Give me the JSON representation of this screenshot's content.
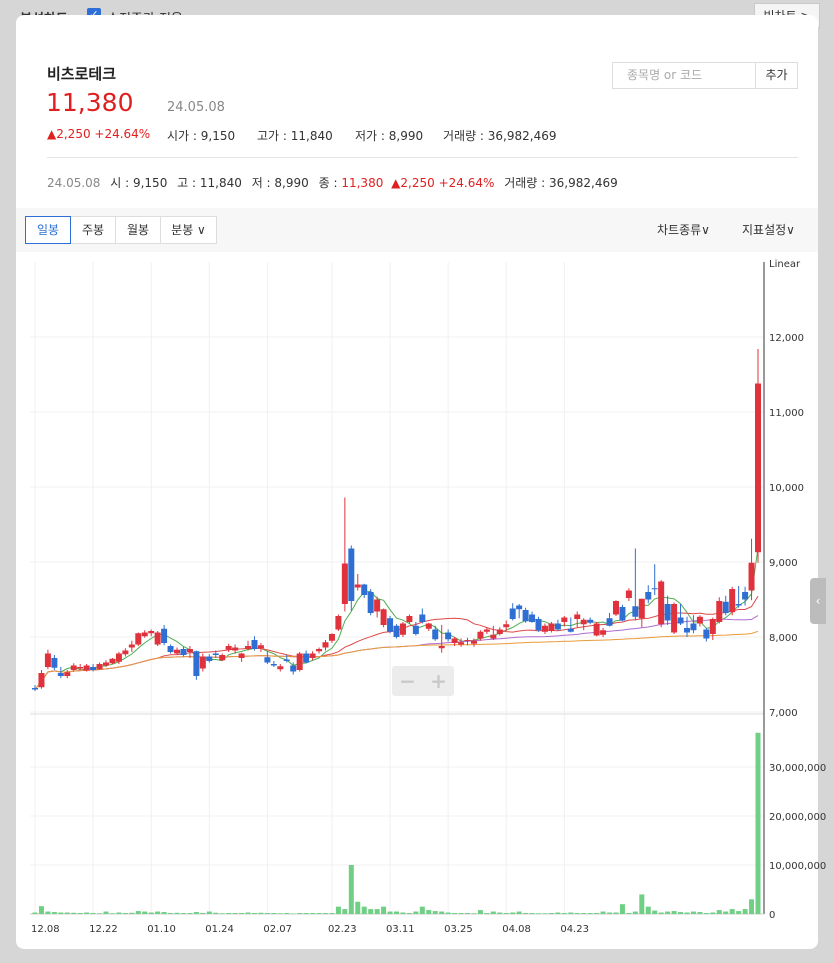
{
  "topbar": {
    "title": "분석차트",
    "adjusted_label": "수정주가 적용",
    "big_chart_label": "빅차트 >"
  },
  "stock": {
    "name": "비츠로테크",
    "price": "11,380",
    "date": "24.05.08",
    "change": "▲2,250 +24.64%"
  },
  "ohlc": {
    "open_label": "시가 : 9,150",
    "high_label": "고가 : 11,840",
    "low_label": "저가 : 8,990",
    "volume_label": "거래량 : 36,982,469"
  },
  "search": {
    "placeholder": "종목명 or 코드",
    "add_label": "추가"
  },
  "summary": {
    "date": "24.05.08",
    "open": "시 : 9,150",
    "high": "고 : 11,840",
    "low": "저 : 8,990",
    "close_label": "종 :",
    "close_value": "11,380",
    "change": "▲2,250 +24.64%",
    "volume": "거래량 : 36,982,469"
  },
  "tabs": [
    {
      "label": "일봉",
      "active": true
    },
    {
      "label": "주봉",
      "active": false
    },
    {
      "label": "월봉",
      "active": false
    },
    {
      "label": "분봉 ∨",
      "active": false
    }
  ],
  "menus": {
    "chart_type": "차트종류∨",
    "indicator": "지표설정∨"
  },
  "zoom": {
    "minus": "−",
    "plus": "+"
  },
  "handle": {
    "icon": "‹"
  },
  "colors": {
    "up": "#e0323c",
    "down": "#2f6fd3",
    "volume": "#6fcf85",
    "ma5": "#4caf50",
    "ma20": "#e04848",
    "ma60": "#b06ad0",
    "ma120": "#e89a3a"
  },
  "chart_data": {
    "type": "candlestick",
    "scale_label": "Linear",
    "price_ticks": [
      "12,000",
      "11,000",
      "10,000",
      "9,000",
      "8,000",
      "7,000"
    ],
    "price_values": [
      12000,
      11000,
      10000,
      9000,
      8000,
      7000
    ],
    "volume_ticks": [
      "30,000,000",
      "20,000,000",
      "10,000,000",
      "0"
    ],
    "volume_values": [
      30000000,
      20000000,
      10000000,
      0
    ],
    "x_labels": [
      "12.08",
      "12.22",
      "01.10",
      "01.24",
      "02.07",
      "02.23",
      "03.11",
      "03.25",
      "04.08",
      "04.23"
    ],
    "candles": [
      [
        7320,
        7360,
        7280,
        7300,
        300000
      ],
      [
        7330,
        7560,
        7310,
        7520,
        1600000
      ],
      [
        7600,
        7830,
        7570,
        7780,
        500000
      ],
      [
        7720,
        7760,
        7560,
        7590,
        400000
      ],
      [
        7520,
        7600,
        7450,
        7480,
        300000
      ],
      [
        7480,
        7560,
        7450,
        7530,
        300000
      ],
      [
        7560,
        7650,
        7540,
        7620,
        250000
      ],
      [
        7580,
        7640,
        7560,
        7600,
        200000
      ],
      [
        7550,
        7640,
        7540,
        7620,
        300000
      ],
      [
        7600,
        7640,
        7540,
        7560,
        200000
      ],
      [
        7570,
        7660,
        7560,
        7640,
        150000
      ],
      [
        7620,
        7690,
        7600,
        7660,
        500000
      ],
      [
        7650,
        7720,
        7640,
        7710,
        150000
      ],
      [
        7670,
        7800,
        7640,
        7780,
        300000
      ],
      [
        7770,
        7850,
        7740,
        7820,
        200000
      ],
      [
        7860,
        7950,
        7800,
        7900,
        250000
      ],
      [
        7900,
        8060,
        7880,
        8050,
        600000
      ],
      [
        8010,
        8090,
        7990,
        8060,
        500000
      ],
      [
        8050,
        8100,
        8010,
        8080,
        300000
      ],
      [
        7900,
        8080,
        7880,
        8060,
        500000
      ],
      [
        8110,
        8160,
        7890,
        7920,
        400000
      ],
      [
        7880,
        7900,
        7780,
        7800,
        200000
      ],
      [
        7780,
        7860,
        7760,
        7830,
        250000
      ],
      [
        7840,
        7870,
        7740,
        7760,
        200000
      ],
      [
        7800,
        7880,
        7720,
        7840,
        200000
      ],
      [
        7810,
        7820,
        7430,
        7480,
        400000
      ],
      [
        7580,
        7780,
        7540,
        7740,
        200000
      ],
      [
        7740,
        7770,
        7660,
        7680,
        500000
      ],
      [
        7780,
        7820,
        7720,
        7760,
        250000
      ],
      [
        7690,
        7780,
        7680,
        7760,
        150000
      ],
      [
        7830,
        7910,
        7800,
        7880,
        200000
      ],
      [
        7820,
        7900,
        7780,
        7860,
        200000
      ],
      [
        7720,
        7790,
        7670,
        7780,
        200000
      ],
      [
        7840,
        7950,
        7820,
        7880,
        300000
      ],
      [
        7960,
        8010,
        7820,
        7840,
        200000
      ],
      [
        7850,
        7920,
        7800,
        7890,
        250000
      ],
      [
        7730,
        7810,
        7640,
        7660,
        200000
      ],
      [
        7640,
        7680,
        7600,
        7620,
        200000
      ],
      [
        7570,
        7640,
        7540,
        7610,
        150000
      ],
      [
        7700,
        7760,
        7660,
        7680,
        200000
      ],
      [
        7620,
        7660,
        7500,
        7540,
        100000
      ],
      [
        7560,
        7800,
        7540,
        7780,
        200000
      ],
      [
        7780,
        7820,
        7650,
        7660,
        200000
      ],
      [
        7720,
        7810,
        7690,
        7780,
        200000
      ],
      [
        7810,
        7860,
        7780,
        7840,
        200000
      ],
      [
        7860,
        7960,
        7820,
        7930,
        200000
      ],
      [
        7950,
        8050,
        7920,
        8040,
        200000
      ],
      [
        8100,
        8300,
        8080,
        8280,
        1500000
      ],
      [
        8440,
        9860,
        8340,
        8980,
        1000000
      ],
      [
        9180,
        9220,
        8350,
        8480,
        10000000
      ],
      [
        8660,
        8840,
        8620,
        8700,
        2500000
      ],
      [
        8700,
        8710,
        8520,
        8560,
        1500000
      ],
      [
        8600,
        8640,
        8290,
        8320,
        1000000
      ],
      [
        8340,
        8540,
        8260,
        8500,
        1000000
      ],
      [
        8160,
        8380,
        8130,
        8370,
        1500000
      ],
      [
        8250,
        8280,
        8050,
        8070,
        500000
      ],
      [
        8150,
        8170,
        7980,
        8000,
        500000
      ],
      [
        8030,
        8200,
        8000,
        8180,
        300000
      ],
      [
        8200,
        8300,
        8180,
        8280,
        200000
      ],
      [
        8150,
        8200,
        8020,
        8040,
        500000
      ],
      [
        8300,
        8380,
        8180,
        8200,
        1500000
      ],
      [
        8110,
        8190,
        8080,
        8180,
        800000
      ],
      [
        8100,
        8150,
        7950,
        7970,
        600000
      ],
      [
        7850,
        8160,
        7790,
        7880,
        500000
      ],
      [
        8060,
        8100,
        7940,
        7970,
        300000
      ],
      [
        7920,
        8000,
        7880,
        7980,
        200000
      ],
      [
        7900,
        7980,
        7870,
        7930,
        200000
      ],
      [
        7950,
        7990,
        7890,
        7960,
        200000
      ],
      [
        7910,
        7980,
        7870,
        7950,
        150000
      ],
      [
        7980,
        8090,
        7950,
        8070,
        800000
      ],
      [
        8070,
        8130,
        8040,
        8100,
        200000
      ],
      [
        7980,
        8150,
        7960,
        8030,
        500000
      ],
      [
        8040,
        8130,
        8020,
        8100,
        300000
      ],
      [
        8130,
        8220,
        8080,
        8170,
        200000
      ],
      [
        8380,
        8450,
        8220,
        8240,
        300000
      ],
      [
        8420,
        8440,
        8250,
        8370,
        500000
      ],
      [
        8360,
        8390,
        8190,
        8210,
        200000
      ],
      [
        8300,
        8340,
        8190,
        8200,
        200000
      ],
      [
        8240,
        8270,
        8070,
        8090,
        150000
      ],
      [
        8070,
        8180,
        8040,
        8150,
        150000
      ],
      [
        8080,
        8200,
        8060,
        8180,
        200000
      ],
      [
        8180,
        8230,
        8080,
        8100,
        300000
      ],
      [
        8200,
        8280,
        8140,
        8260,
        200000
      ],
      [
        8110,
        8260,
        8060,
        8070,
        300000
      ],
      [
        8240,
        8340,
        8130,
        8300,
        200000
      ],
      [
        8170,
        8250,
        8090,
        8230,
        200000
      ],
      [
        8230,
        8260,
        8170,
        8190,
        200000
      ],
      [
        8020,
        8200,
        8010,
        8180,
        200000
      ],
      [
        8030,
        8120,
        8000,
        8090,
        500000
      ],
      [
        8250,
        8320,
        8140,
        8150,
        300000
      ],
      [
        8300,
        8490,
        8280,
        8480,
        300000
      ],
      [
        8400,
        8430,
        8210,
        8220,
        2000000
      ],
      [
        8520,
        8650,
        8480,
        8620,
        200000
      ],
      [
        8410,
        9180,
        8220,
        8270,
        500000
      ],
      [
        8250,
        8510,
        8130,
        8510,
        4000000
      ],
      [
        8600,
        8690,
        8450,
        8500,
        1500000
      ],
      [
        8650,
        8970,
        8560,
        8640,
        700000
      ],
      [
        8170,
        8760,
        8130,
        8740,
        300000
      ],
      [
        8440,
        8550,
        8160,
        8220,
        500000
      ],
      [
        8060,
        8460,
        8040,
        8440,
        600000
      ],
      [
        8260,
        8440,
        8160,
        8180,
        400000
      ],
      [
        8120,
        8270,
        8000,
        8060,
        300000
      ],
      [
        8180,
        8290,
        8050,
        8090,
        500000
      ],
      [
        8180,
        8290,
        8140,
        8270,
        400000
      ],
      [
        8100,
        8120,
        7940,
        7980,
        200000
      ],
      [
        8040,
        8260,
        7960,
        8240,
        300000
      ],
      [
        8200,
        8530,
        8180,
        8480,
        800000
      ],
      [
        8470,
        8550,
        8290,
        8320,
        500000
      ],
      [
        8330,
        8670,
        8290,
        8640,
        1000000
      ],
      [
        8440,
        8680,
        8390,
        8420,
        600000
      ],
      [
        8600,
        8670,
        8420,
        8500,
        1000000
      ],
      [
        8620,
        9310,
        8490,
        8990,
        3000000
      ],
      [
        9130,
        11840,
        8990,
        11380,
        36982469
      ]
    ]
  }
}
